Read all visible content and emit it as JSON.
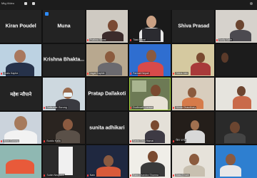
{
  "window": {
    "title": "Mtg.Video"
  },
  "colors": {
    "background": "#121212",
    "tile": "#232323",
    "active_speaker": "#a8d840",
    "muted_mic": "#ff3b3b"
  },
  "tiles": [
    {
      "label": "Kiran Poudel",
      "style": "name"
    },
    {
      "label": "Muna",
      "style": "name"
    },
    {
      "label": "Pratima Silwal",
      "style": "video"
    },
    {
      "label": "Tilak Nepal",
      "style": "video"
    },
    {
      "label": "Shiva Prasad",
      "style": "name"
    },
    {
      "label": "Sudip Kafle",
      "style": "video"
    },
    {
      "label": "Thalu Kaphe",
      "style": "video"
    },
    {
      "label": "Krishna  Bhakta...",
      "style": "name"
    },
    {
      "label": "Jagat Kaphle",
      "style": "video"
    },
    {
      "label": "Parbati Nepali",
      "style": "video"
    },
    {
      "label": "Nisha Jain",
      "style": "video"
    },
    {
      "label": "",
      "style": "video"
    },
    {
      "label": "महेश न्यौपाने",
      "style": "name"
    },
    {
      "label": "Satkumar Gurung",
      "style": "video"
    },
    {
      "label": "Pratap Dallakoti",
      "style": "name"
    },
    {
      "label": "Dudhnath Lamsal",
      "style": "video"
    },
    {
      "label": "Nimta Chaudhary",
      "style": "video"
    },
    {
      "label": "",
      "style": "video"
    },
    {
      "label": "Bhim Gurung",
      "style": "video"
    },
    {
      "label": "Buddu Kaila",
      "style": "video"
    },
    {
      "label": "sunita adhikari",
      "style": "name"
    },
    {
      "label": "Santa Dhoj Hamal",
      "style": "video"
    },
    {
      "label": "बिना पाण्डे",
      "style": "video"
    },
    {
      "label": "",
      "style": "video"
    },
    {
      "label": "",
      "style": "video"
    },
    {
      "label": "Subin Neupane",
      "style": "video"
    },
    {
      "label": "Nain",
      "style": "video"
    },
    {
      "label": "Ram Chandra Sharma",
      "style": "video"
    },
    {
      "label": "Basu Khatri",
      "style": "video"
    },
    {
      "label": "",
      "style": "video"
    }
  ]
}
